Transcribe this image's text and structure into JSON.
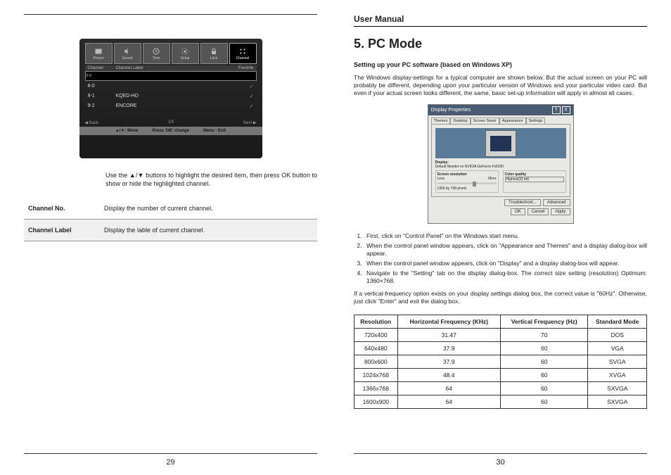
{
  "left": {
    "page_no": "29",
    "osd": {
      "tabs": [
        "Picture",
        "Sound",
        "Time",
        "Setup",
        "Lock",
        "Channel"
      ],
      "active_tab_index": 5,
      "columns": [
        "Channel",
        "Channel Label",
        "Favorite"
      ],
      "rows": [
        {
          "ch": "2-0",
          "label": "",
          "fav": ""
        },
        {
          "ch": "8-0",
          "label": "",
          "fav": "✓"
        },
        {
          "ch": "9-1",
          "label": "KQED-HD",
          "fav": "✓"
        },
        {
          "ch": "9-2",
          "label": "ENCORE",
          "fav": "✓"
        }
      ],
      "left_hint": "◀ Back",
      "right_hint": "Next ▶",
      "page_hint": "1/9",
      "footer_move": "▲/▼: Move",
      "footer_ok": "Press 'OK' change",
      "footer_exit": "Menu : Exit"
    },
    "instruction": "Use the ▲/▼ buttons to highlight the desired item, then press OK button to show or hide the highlighted channel.",
    "defs": [
      {
        "k": "Channel No.",
        "v": "Display the number of current channel."
      },
      {
        "k": "Channel Label",
        "v": "Display the lable of current channel."
      }
    ]
  },
  "right": {
    "page_no": "30",
    "header": "User Manual",
    "title": "5. PC Mode",
    "subtitle": "Setting up your PC software (based on Windows XP)",
    "intro": "The Windows display-settings for a typical computer are shown below. But the actual screen on your PC will probably be different, depending upon your particular version of Windows and your particular video card. But even if your actual screen looks different, the same, basic set-up information will apply in almost all cases.",
    "win": {
      "title": "Display Properties",
      "tabs": [
        "Themes",
        "Desktop",
        "Screen Saver",
        "Appearance",
        "Settings"
      ],
      "display_label": "Display:",
      "display_value": "Default Monitor on NVIDIA GeForce Fx5200",
      "res_label": "Screen resolution",
      "res_scale_l": "Less",
      "res_scale_r": "More",
      "res_value": "1366 by 768 pixels",
      "color_label": "Color quality",
      "color_value": "Highest(32 bit)",
      "btn_ts": "Troubleshoot...",
      "btn_adv": "Advanced",
      "btn_ok": "OK",
      "btn_cancel": "Cancel",
      "btn_apply": "Apply"
    },
    "steps": [
      "First, click on \"Control Panel\" on the Windows start menu.",
      "When the control panel window appears, click on \"Appearance and Themes\" and a display dialog-box will appear.",
      "When the control panel window appears, click on \"Display\" and a display dialog-box will appear.",
      "Navigate to the \"Setting\" tab on the display dialog-box. The correct size setting (resolution) Optimum: 1360×768."
    ],
    "note": "If a vertical-frequency option exists on your display settings dialog box, the correct value is \"60Hz\". Otherwise, just click \"Enter\" and exit the dialog box.",
    "table": {
      "headers": [
        "Resolution",
        "Horizontal Frequency (KHz)",
        "Vertical Frequency (Hz)",
        "Standard Mode"
      ],
      "rows": [
        [
          "720x400",
          "31.47",
          "70",
          "DOS"
        ],
        [
          "640x480",
          "37.9",
          "60",
          "VGA"
        ],
        [
          "800x600",
          "37.9",
          "60",
          "SVGA"
        ],
        [
          "1024x768",
          "48.4",
          "60",
          "XVGA"
        ],
        [
          "1366x768",
          "64",
          "60",
          "SXVGA"
        ],
        [
          "1600x900",
          "64",
          "60",
          "SXVGA"
        ]
      ]
    }
  }
}
